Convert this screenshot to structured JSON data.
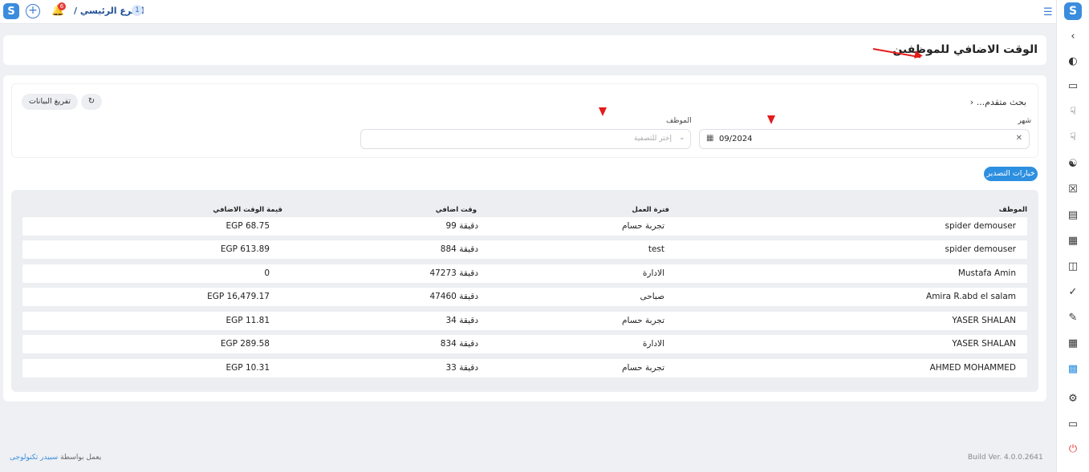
{
  "topbar": {
    "branch_label": "الفرع الرئيسي /",
    "branch_count": "1",
    "notification_count": "6"
  },
  "page": {
    "title": "الوقت الاضافي للموظفين"
  },
  "filters": {
    "advanced_search": "بحث متقدم...",
    "month_label": "شهر",
    "month_value": "09/2024",
    "employee_label": "الموظف",
    "employee_placeholder": "إختر للتصفية",
    "unload_button": "تفريغ البيانات"
  },
  "export_button": "خيارات التصدير",
  "table": {
    "headers": {
      "employee": "الموظف",
      "shift": "فترة العمل",
      "overtime": "وقت اضافي",
      "overtime_value": "قيمة الوقت الاضافي"
    },
    "rows": [
      {
        "employee": "spider demouser",
        "shift": "تجربة حسام",
        "overtime": "99 دقيقة",
        "value": "EGP 68.75"
      },
      {
        "employee": "spider demouser",
        "shift": "test",
        "overtime": "884 دقيقة",
        "value": "EGP 613.89"
      },
      {
        "employee": "Mustafa Amin",
        "shift": "الادارة",
        "overtime": "47273 دقيقة",
        "value": "0"
      },
      {
        "employee": "Amira R.abd el salam",
        "shift": "صباحى",
        "overtime": "47460 دقيقة",
        "value": "EGP 16,479.17"
      },
      {
        "employee": "YASER SHALAN",
        "shift": "تجربة حسام",
        "overtime": "34 دقيقة",
        "value": "EGP 11.81"
      },
      {
        "employee": "YASER SHALAN",
        "shift": "الادارة",
        "overtime": "834 دقيقة",
        "value": "EGP 289.58"
      },
      {
        "employee": "AHMED MOHAMMED",
        "shift": "تجربة حسام",
        "overtime": "33 دقيقة",
        "value": "EGP 10.31"
      }
    ]
  },
  "footer": {
    "powered_by": "يعمل بواسطة",
    "brand": "سبيدر تكنولوجى",
    "build": "Build Ver. 4.0.0.2641"
  },
  "colors": {
    "accent": "#2d8fe0",
    "annotation": "#e31b1b"
  }
}
